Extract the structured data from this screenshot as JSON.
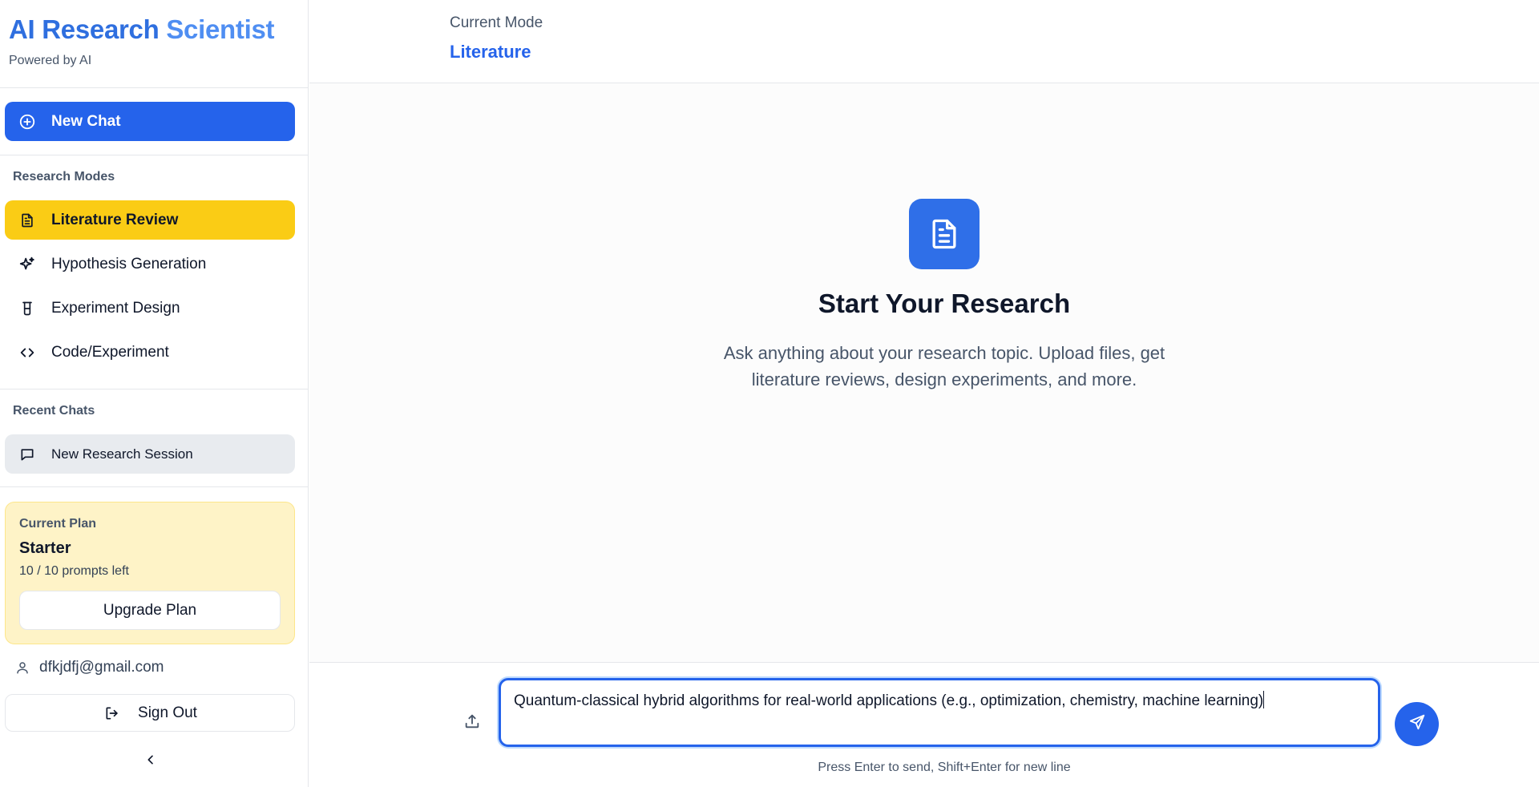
{
  "brand": {
    "title_part1": "AI Research",
    "title_part2": "Scientist",
    "subtitle": "Powered by AI"
  },
  "sidebar": {
    "new_chat_label": "New Chat",
    "modes_heading": "Research Modes",
    "modes": [
      {
        "label": "Literature Review",
        "icon": "document-icon",
        "active": true
      },
      {
        "label": "Hypothesis Generation",
        "icon": "sparkles-icon",
        "active": false
      },
      {
        "label": "Experiment Design",
        "icon": "flask-icon",
        "active": false
      },
      {
        "label": "Code/Experiment",
        "icon": "code-icon",
        "active": false
      }
    ],
    "recent_heading": "Recent Chats",
    "recent_chats": [
      {
        "label": "New Research Session",
        "icon": "chat-bubble-icon"
      }
    ],
    "plan": {
      "label": "Current Plan",
      "name": "Starter",
      "prompts_left": "10 / 10 prompts left",
      "upgrade_label": "Upgrade Plan"
    },
    "user_email": "dfkjdfj@gmail.com",
    "sign_out_label": "Sign Out"
  },
  "header": {
    "mode_caption": "Current Mode",
    "mode_value": "Literature"
  },
  "hero": {
    "title": "Start Your Research",
    "description": "Ask anything about your research topic. Upload files, get literature reviews, design experiments, and more."
  },
  "composer": {
    "input_value": "Quantum-classical hybrid algorithms for real-world applications (e.g., optimization, chemistry, machine learning)",
    "hint": "Press Enter to send, Shift+Enter for new line"
  },
  "colors": {
    "accent": "#2563eb",
    "active_mode": "#facc15",
    "plan_card": "#fef3c7"
  }
}
